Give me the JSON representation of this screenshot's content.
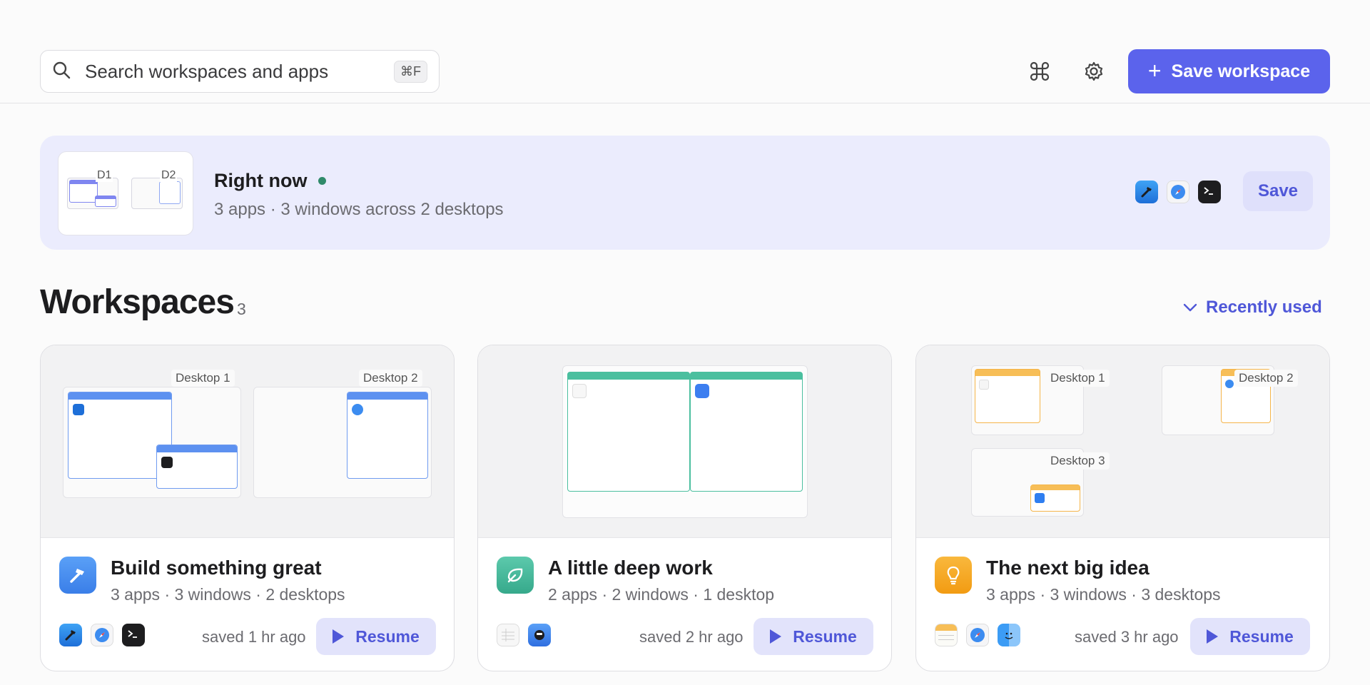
{
  "search": {
    "placeholder": "Search workspaces and apps",
    "shortcut": "⌘F"
  },
  "header": {
    "save_label": "Save workspace"
  },
  "now": {
    "title": "Right now",
    "subtitle": "3 apps · 3 windows across 2 desktops",
    "desktops": [
      "D1",
      "D2"
    ],
    "apps": [
      "xcode-icon",
      "safari-icon",
      "terminal-icon"
    ],
    "save_label": "Save"
  },
  "section": {
    "title": "Workspaces",
    "count": "3",
    "sort_label": "Recently used"
  },
  "cards": [
    {
      "name": "Build something great",
      "meta": "3 apps · 3 windows · 2 desktops",
      "saved": "saved 1 hr ago",
      "resume": "Resume",
      "desktops": [
        "Desktop 1",
        "Desktop 2"
      ],
      "icon": "hammer-icon",
      "accent": "#4b8df2",
      "apps": [
        "xcode-icon",
        "safari-icon",
        "terminal-icon"
      ]
    },
    {
      "name": "A little deep work",
      "meta": "2 apps · 2 windows · 1 desktop",
      "saved": "saved 2 hr ago",
      "resume": "Resume",
      "desktops": [],
      "icon": "leaf-icon",
      "accent": "#3fb89a",
      "apps": [
        "numbers-icon",
        "tasks-icon"
      ]
    },
    {
      "name": "The next big idea",
      "meta": "3 apps · 3 windows · 3 desktops",
      "saved": "saved 3 hr ago",
      "resume": "Resume",
      "desktops": [
        "Desktop 1",
        "Desktop 2",
        "Desktop 3"
      ],
      "icon": "lightbulb-icon",
      "accent": "#f5a623",
      "apps": [
        "notes-icon",
        "safari-icon",
        "finder-icon"
      ]
    }
  ],
  "colors": {
    "accent": "#5b63ec",
    "banner": "#ebecfd",
    "live": "#2f8a6a"
  }
}
